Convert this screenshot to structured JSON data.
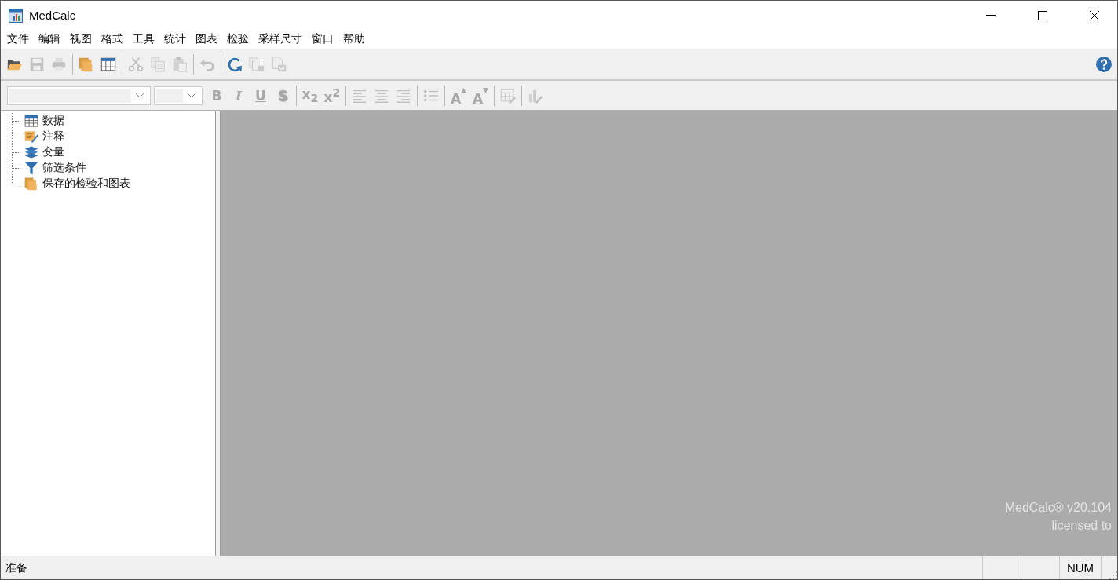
{
  "window": {
    "title": "MedCalc"
  },
  "menu": [
    "文件",
    "编辑",
    "视图",
    "格式",
    "工具",
    "统计",
    "图表",
    "检验",
    "采样尺寸",
    "窗口",
    "帮助"
  ],
  "toolbar": [
    {
      "kind": "open",
      "disabled": false
    },
    {
      "kind": "save",
      "disabled": true
    },
    {
      "kind": "print",
      "disabled": true
    },
    {
      "kind": "separator"
    },
    {
      "kind": "pages",
      "disabled": false
    },
    {
      "kind": "grid",
      "disabled": false
    },
    {
      "kind": "separator"
    },
    {
      "kind": "cut",
      "disabled": true
    },
    {
      "kind": "copy",
      "disabled": true
    },
    {
      "kind": "paste",
      "disabled": true
    },
    {
      "kind": "separator"
    },
    {
      "kind": "undo",
      "disabled": true
    },
    {
      "kind": "separator"
    },
    {
      "kind": "refresh",
      "disabled": false
    },
    {
      "kind": "copy-save",
      "disabled": true
    },
    {
      "kind": "export",
      "disabled": true
    }
  ],
  "format_toolbar": [
    {
      "kind": "bold",
      "label": "B",
      "disabled": true
    },
    {
      "kind": "italic",
      "label": "I",
      "disabled": true
    },
    {
      "kind": "underline",
      "label": "U",
      "disabled": true
    },
    {
      "kind": "shadow",
      "label": "S",
      "disabled": true
    },
    {
      "kind": "separator"
    },
    {
      "kind": "subscript",
      "label": "x$_{2}$",
      "disabled": true
    },
    {
      "kind": "superscript",
      "label": "x$^{2}$",
      "disabled": true
    },
    {
      "kind": "separator"
    },
    {
      "kind": "align-left",
      "disabled": true
    },
    {
      "kind": "align-center",
      "disabled": true
    },
    {
      "kind": "align-right",
      "disabled": true
    },
    {
      "kind": "separator"
    },
    {
      "kind": "list",
      "disabled": true
    },
    {
      "kind": "separator"
    },
    {
      "kind": "grow",
      "label": "A",
      "disabled": true
    },
    {
      "kind": "shrink",
      "label": "A",
      "disabled": true
    },
    {
      "kind": "separator"
    },
    {
      "kind": "table-edit",
      "disabled": true
    },
    {
      "kind": "separator"
    },
    {
      "kind": "chart-edit",
      "disabled": true
    }
  ],
  "tree": [
    {
      "label": "数据",
      "kind": "grid"
    },
    {
      "label": "注释",
      "kind": "notes"
    },
    {
      "label": "变量",
      "kind": "layers"
    },
    {
      "label": "筛选条件",
      "kind": "filter"
    },
    {
      "label": "保存的检验和图表",
      "kind": "pages"
    }
  ],
  "workspace": {
    "lines": [
      "MedCalc® v20.104",
      "licensed to"
    ]
  },
  "status_bar": {
    "text": "准备",
    "indicators": [
      "NUM"
    ]
  }
}
